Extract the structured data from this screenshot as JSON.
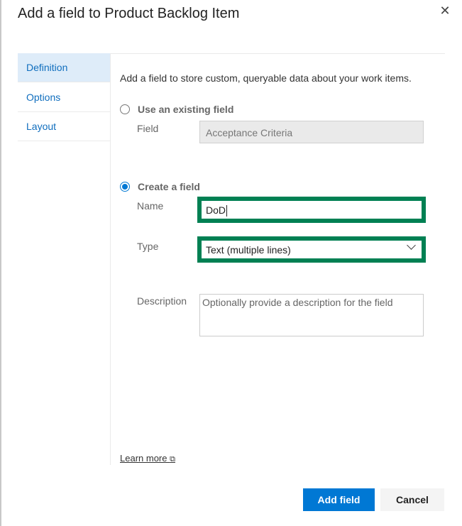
{
  "dialog": {
    "title": "Add a field to Product Backlog Item",
    "close_icon": "close-icon"
  },
  "sidebar": {
    "items": [
      {
        "label": "Definition",
        "selected": true
      },
      {
        "label": "Options"
      },
      {
        "label": "Layout"
      }
    ]
  },
  "main": {
    "intro": "Add a field to store custom, queryable data about your work items.",
    "existing": {
      "label": "Use an existing field",
      "selected": false,
      "field_label": "Field",
      "field_value": "Acceptance Criteria"
    },
    "create": {
      "label": "Create a field",
      "selected": true,
      "name_label": "Name",
      "name_value": "DoD",
      "type_label": "Type",
      "type_value": "Text (multiple lines)",
      "description_label": "Description",
      "description_placeholder": "Optionally provide a description for the field"
    },
    "learn_more": "Learn more",
    "highlight_color": "#008053"
  },
  "footer": {
    "add_label": "Add field",
    "cancel_label": "Cancel"
  }
}
